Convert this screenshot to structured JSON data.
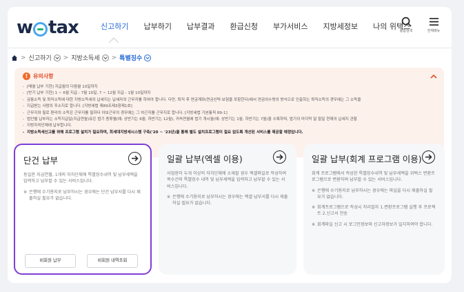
{
  "header": {
    "logo_text_left": "w",
    "logo_text_right": "tax",
    "nav": [
      "신고하기",
      "납부하기",
      "납부결과",
      "환급신청",
      "부가서비스",
      "지방세정보",
      "나의 위택스"
    ],
    "active_nav": "신고하기",
    "icons": [
      {
        "name": "search-icon",
        "label": "통합검색"
      },
      {
        "name": "menu-icon",
        "label": "전체메뉴"
      }
    ]
  },
  "breadcrumb": {
    "home_icon": "home-icon",
    "items": [
      "신고하기",
      "지방소득세",
      "특별징수"
    ]
  },
  "notice": {
    "title": "유의사항",
    "lines": [
      "[매월 납부 기한] 지급월의 다음월 10일까지",
      "[반기 납부 기한] 1 ~ 6월 지급 : 7월 10일, 7 ~ 12월 지급 : 1월 10일까지",
      "금융소득 및 퇴직소득에 대한 지방소득세의 납세지는 납세자의 근무지를 하여야 합니다. 다만, 퇴직 후 연금계좌(연금신탁·보험을 포함한다)에서 연금외수령의 방식으로 인출하는 퇴직소득의 경우에는 그 소득을",
      "지급받는 사람의 주소지로 합니다. [지방세법 제89조제3항제1호]",
      "근무지와 필로 편라의 소득은 근무지를 필하다 아보근무의 경우에는 그 차근지를 근무지로 합니다. [지방세법 기본통칙 89-1]",
      "법인별 납부자는 소득지급일(지급연월)유은 법기 종류별(예: 상반기는 6월, 하반기는 12월), 귀속연월에 법기 개시월(예: 상반기는 1월, 하반기는 7월)을 수록하며, 법기의 마지막 달 말일 현재의 납세지 관할",
      "지방자치단체에 납부합니다.",
      "지방소득세신고를 위해 프로그램 설치가 필요하며, 회세대지방세시스템 구축('20 ~ '23년)을 통해 별도 설치프로그램이 필요 없도록 개선된 서비스를 제공할 예정입니다."
    ]
  },
  "cards": [
    {
      "title": "단건 납부",
      "desc": "동일한 지급연월, 1개의 자치단체에 특별징수내역 및 납부세액을 입력하고 납부할 수 있는 서비스입니다.",
      "notes": [
        "은행에 수기용지로 납부하시는 경우에는 단건 납부서를 다시 제출하실 필요가 없습니다."
      ],
      "buttons": [
        "비회원 납부",
        "비회원 내역조회"
      ],
      "selected": true
    },
    {
      "title": "일괄 납부(엑셀 이용)",
      "desc": "사업장이 두개 이상의 자치단체에 소재할 경우 엑셀파일로 작성하여 복수건의 특별징수 내역 및 납부세액을 입력하고 납부할 수 있는 서비스입니다.",
      "notes": [
        "은행에 수기용지로 납부하시는 경우에는 엑셀 납부서를 다시 제출하실 필요가 없습니다."
      ],
      "buttons": [],
      "selected": false
    },
    {
      "title": "일괄 납부(회계 프로그램 이용)",
      "desc": "회계 프로그램에서 작성한 특별징수내역 및 납부세액을 위택스 변환프로그램으로 변환하여 납부할 수 있는 서비스입니다.",
      "notes": [
        "은행에 수기용지로 납부하시는 경우에는 파일을 다시 제출하실 필요가 없습니다.",
        "회계프로그램으로 작성시 처리절차 1.변환프로그램 실행 후 프로젝트 2.신고서 전송",
        "회계파일 신고 시 로그인정보와 신고자정보가 일치하여야 합니다."
      ],
      "buttons": [],
      "selected": false
    }
  ],
  "colors": {
    "brand_blue": "#1f66d6",
    "selected_border": "#7d3dd6",
    "notice_bg": "#fdf1ec",
    "warn": "#f06b2a"
  }
}
